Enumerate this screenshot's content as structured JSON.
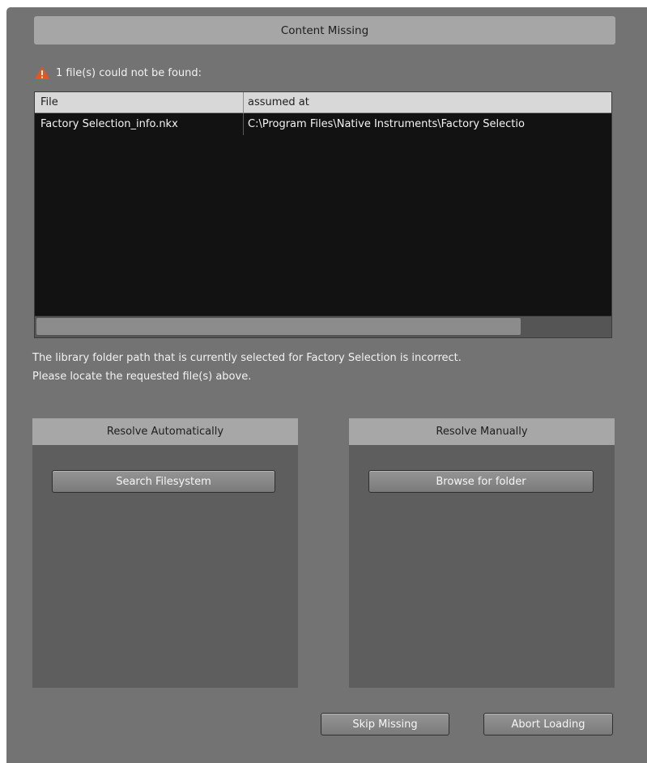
{
  "dialog": {
    "title": "Content Missing"
  },
  "warning": {
    "text": "1 file(s) could not be found:",
    "icon": "warning-triangle-icon",
    "icon_color": "#e8541b"
  },
  "table": {
    "columns": [
      "File",
      "assumed at"
    ],
    "rows": [
      [
        "Factory Selection_info.nkx",
        "C:\\Program Files\\Native Instruments\\Factory Selectio"
      ]
    ],
    "scroll_position": 0
  },
  "message": {
    "line1": "The library folder path that is currently selected for Factory Selection is incorrect.",
    "line2": "Please locate the requested file(s) above."
  },
  "panels": {
    "auto": {
      "title": "Resolve Automatically",
      "button": "Search Filesystem"
    },
    "manual": {
      "title": "Resolve Manually",
      "button": "Browse for folder"
    }
  },
  "footer": {
    "skip": "Skip Missing",
    "abort": "Abort Loading"
  },
  "colors": {
    "background": "#737373",
    "panel": "#5e5e5e",
    "table_bg": "#121212",
    "header_bg": "#a6a6a6"
  }
}
